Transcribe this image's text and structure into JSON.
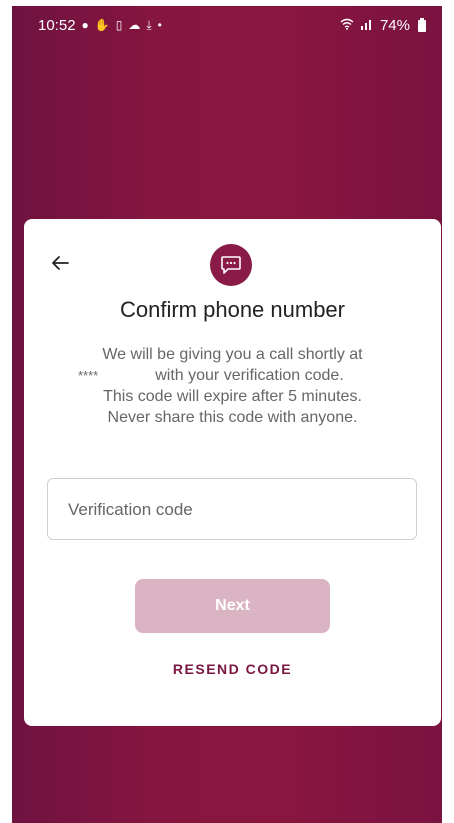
{
  "status_bar": {
    "time": "10:52",
    "battery": "74%",
    "left_icons": [
      "location-icon",
      "hand-icon",
      "sim-icon",
      "cloud-icon",
      "download-icon",
      "dot-icon"
    ],
    "right_icons": [
      "wifi-icon",
      "signal-icon",
      "battery-icon"
    ]
  },
  "dialog": {
    "icon": "chat-bubble-icon",
    "title": "Confirm phone number",
    "body_line1": "We will be giving you a call shortly at",
    "masked_number": "****",
    "body_line2": "with your verification code.",
    "body_line3": "This code will expire after 5 minutes.",
    "body_line4": "Never share this code with anyone.",
    "input_placeholder": "Verification code",
    "next_label": "Next",
    "resend_label": "RESEND CODE"
  },
  "colors": {
    "background": "#86163f",
    "accent": "#8a1a47",
    "button_disabled": "#dbb4c4",
    "link": "#7a1640"
  }
}
